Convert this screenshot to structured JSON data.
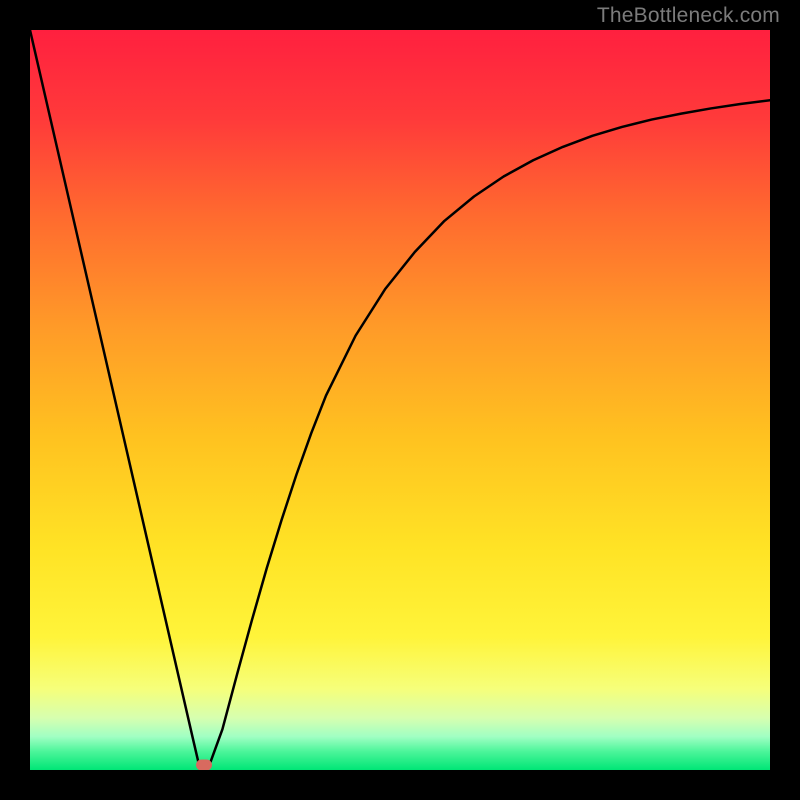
{
  "watermark": "TheBottleneck.com",
  "chart_data": {
    "type": "line",
    "title": "",
    "xlabel": "",
    "ylabel": "",
    "xlim": [
      0,
      100
    ],
    "ylim": [
      0,
      100
    ],
    "x": [
      0,
      2,
      4,
      6,
      8,
      10,
      12,
      14,
      16,
      18,
      20,
      22,
      23,
      24,
      26,
      28,
      30,
      32,
      34,
      36,
      38,
      40,
      44,
      48,
      52,
      56,
      60,
      64,
      68,
      72,
      76,
      80,
      84,
      88,
      92,
      96,
      100
    ],
    "values": [
      100,
      91.3,
      82.6,
      73.9,
      65.2,
      56.5,
      47.8,
      39.1,
      30.4,
      21.7,
      13.0,
      4.3,
      0,
      0,
      5.5,
      13.0,
      20.3,
      27.3,
      33.8,
      39.9,
      45.5,
      50.6,
      58.7,
      65.0,
      70.0,
      74.2,
      77.5,
      80.2,
      82.4,
      84.2,
      85.7,
      86.9,
      87.9,
      88.7,
      89.4,
      90.0,
      90.5
    ],
    "marker": {
      "x": 23.5,
      "y": 0
    },
    "gradient_stops": [
      {
        "pos": 0.0,
        "color": "#ff203f"
      },
      {
        "pos": 0.12,
        "color": "#ff3a3a"
      },
      {
        "pos": 0.25,
        "color": "#ff6a2f"
      },
      {
        "pos": 0.4,
        "color": "#ff9a28"
      },
      {
        "pos": 0.55,
        "color": "#ffc220"
      },
      {
        "pos": 0.7,
        "color": "#ffe325"
      },
      {
        "pos": 0.82,
        "color": "#fff43a"
      },
      {
        "pos": 0.89,
        "color": "#f6ff7a"
      },
      {
        "pos": 0.93,
        "color": "#d6ffb0"
      },
      {
        "pos": 0.955,
        "color": "#a0ffc3"
      },
      {
        "pos": 0.975,
        "color": "#4cf59a"
      },
      {
        "pos": 1.0,
        "color": "#00e676"
      }
    ]
  }
}
